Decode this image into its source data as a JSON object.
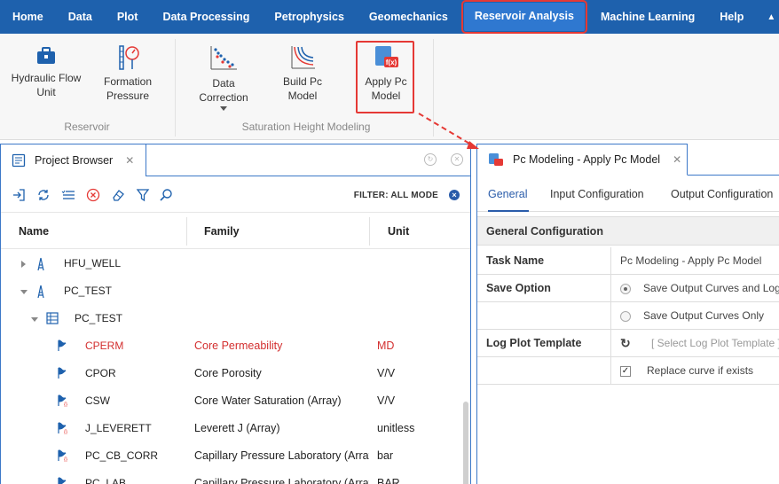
{
  "menu": {
    "items": [
      "Home",
      "Data",
      "Plot",
      "Data Processing",
      "Petrophysics",
      "Geomechanics",
      "Reservoir Analysis",
      "Machine Learning",
      "Help"
    ],
    "active": "Reservoir Analysis",
    "caret": "▲"
  },
  "ribbon": {
    "hydraulic_flow_unit": "Hydraulic Flow Unit",
    "formation_pressure": "Formation Pressure",
    "group_reservoir": "Reservoir",
    "data_correction": "Data Correction",
    "build_pc_model": "Build Pc Model",
    "apply_pc_model": "Apply Pc Model",
    "group_saturation": "Saturation Height Modeling"
  },
  "project_browser": {
    "tab_title": "Project Browser",
    "filter_label": "FILTER: ALL MODE",
    "columns": {
      "name": "Name",
      "family": "Family",
      "unit": "Unit"
    },
    "rows": [
      {
        "name": "HFU_WELL",
        "family": "",
        "unit": ""
      },
      {
        "name": "PC_TEST",
        "family": "",
        "unit": ""
      },
      {
        "name": "PC_TEST",
        "family": "",
        "unit": ""
      },
      {
        "name": "CPERM",
        "family": "Core Permeability",
        "unit": "MD"
      },
      {
        "name": "CPOR",
        "family": "Core Porosity",
        "unit": "V/V"
      },
      {
        "name": "CSW",
        "family": "Core Water Saturation (Array)",
        "unit": "V/V"
      },
      {
        "name": "J_LEVERETT",
        "family": "Leverett J (Array)",
        "unit": "unitless"
      },
      {
        "name": "PC_CB_CORR",
        "family": "Capillary Pressure Laboratory (Array)",
        "unit": "bar"
      },
      {
        "name": "PC_LAB",
        "family": "Capillary Pressure Laboratory (Array)",
        "unit": "BAR"
      }
    ]
  },
  "pc_panel": {
    "tab_title": "Pc Modeling - Apply Pc Model",
    "subtabs": [
      "General",
      "Input Configuration",
      "Output Configuration"
    ],
    "section": "General Configuration",
    "task_name_label": "Task Name",
    "task_name_value": "Pc Modeling - Apply Pc Model",
    "save_option_label": "Save Output Curves and Log-Plot",
    "save_option_label_field": "Save Option",
    "save_curves_only": "Save Output Curves Only",
    "log_plot_template_label": "Log Plot Template",
    "log_plot_template_placeholder": "[ Select Log Plot Template ]",
    "replace_curve": "Replace curve if exists"
  },
  "colors": {
    "menubar": "#1e61ad",
    "highlight_red": "#e53935",
    "accent_blue": "#2a5caa",
    "curve_red": "#d32f2f"
  }
}
